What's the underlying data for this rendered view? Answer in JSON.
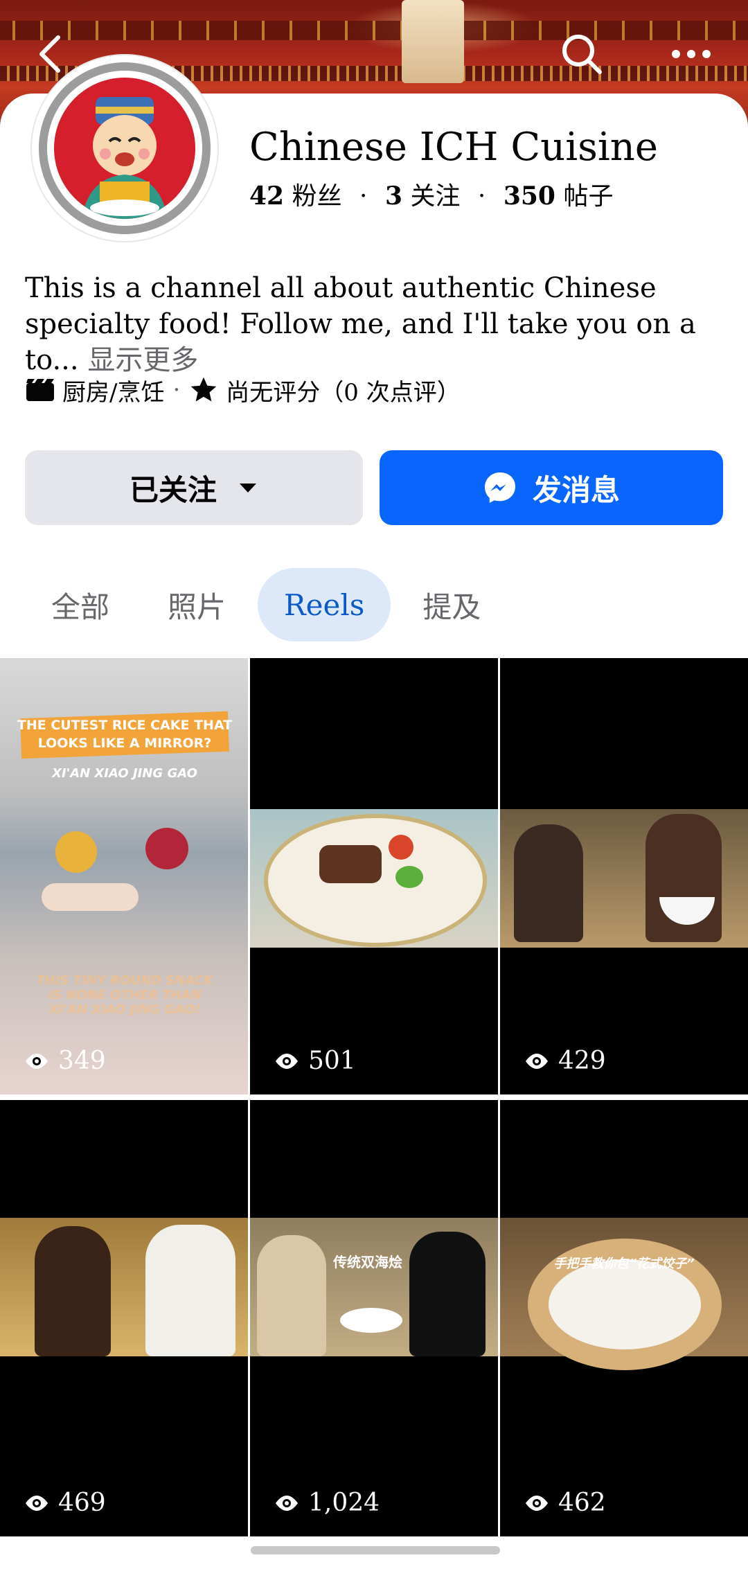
{
  "header": {
    "back_icon": "chevron-left-icon",
    "search_icon": "search-icon",
    "more_icon": "ellipsis-icon"
  },
  "profile": {
    "name": "Chinese ICH Cuisine",
    "followers": "42",
    "followers_label": "粉丝",
    "following": "3",
    "following_label": "关注",
    "posts": "350",
    "posts_label": "帖子",
    "bio": "This is a channel all about authentic Chinese specialty food! Follow me, and I'll take you on a to...",
    "bio_more": "显示更多",
    "category": "厨房/烹饪",
    "rating": "尚无评分（0 次点评）"
  },
  "actions": {
    "following_button": "已关注",
    "message_button": "发消息"
  },
  "tabs": [
    {
      "label": "全部",
      "active": false
    },
    {
      "label": "照片",
      "active": false
    },
    {
      "label": "Reels",
      "active": true
    },
    {
      "label": "提及",
      "active": false
    }
  ],
  "reels": [
    {
      "views": "349",
      "caption_top": "THE CUTEST RICE CAKE THAT LOOKS LIKE A MIRROR?",
      "caption_sub": "XI'AN XIAO JING GAO",
      "caption_bottom": "THIS TINY ROUND SNACK IS NONE OTHER THAN XI'AN XIAO JING GAO!"
    },
    {
      "views": "501"
    },
    {
      "views": "429"
    },
    {
      "views": "469"
    },
    {
      "views": "1,024",
      "caption_top": "传统双海烩"
    },
    {
      "views": "462",
      "caption_top": "手把手教你包“花式饺子”"
    }
  ],
  "colors": {
    "primary": "#0866ff",
    "secondary_button": "#e4e6eb",
    "active_tab_bg": "#dde9f8",
    "active_tab_text": "#0a5ac8"
  }
}
